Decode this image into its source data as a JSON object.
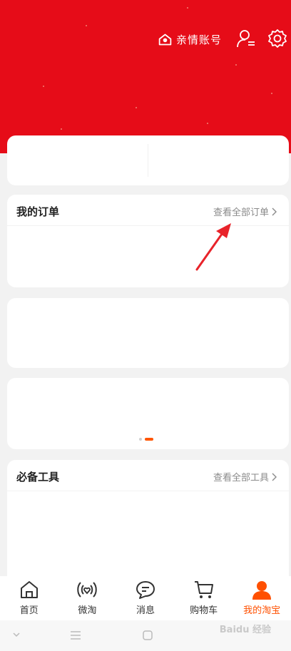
{
  "header": {
    "family_account_label": "亲情账号",
    "icons": [
      "home-shield-icon",
      "user-list-icon",
      "gear-icon"
    ],
    "background_color": "#e60c18"
  },
  "orders": {
    "title": "我的订单",
    "view_all": "查看全部订单"
  },
  "tools": {
    "title": "必备工具",
    "view_all": "查看全部工具"
  },
  "banner": {
    "page_count": 2,
    "active_page": 2
  },
  "tabbar": {
    "active_color": "#ff5000",
    "tabs": [
      {
        "label": "首页",
        "icon": "home-icon"
      },
      {
        "label": "微淘",
        "icon": "broadcast-heart-icon"
      },
      {
        "label": "消息",
        "icon": "chat-bubble-icon"
      },
      {
        "label": "购物车",
        "icon": "cart-icon"
      },
      {
        "label": "我的淘宝",
        "icon": "profile-icon"
      }
    ]
  },
  "watermark": "Baidu 经验"
}
